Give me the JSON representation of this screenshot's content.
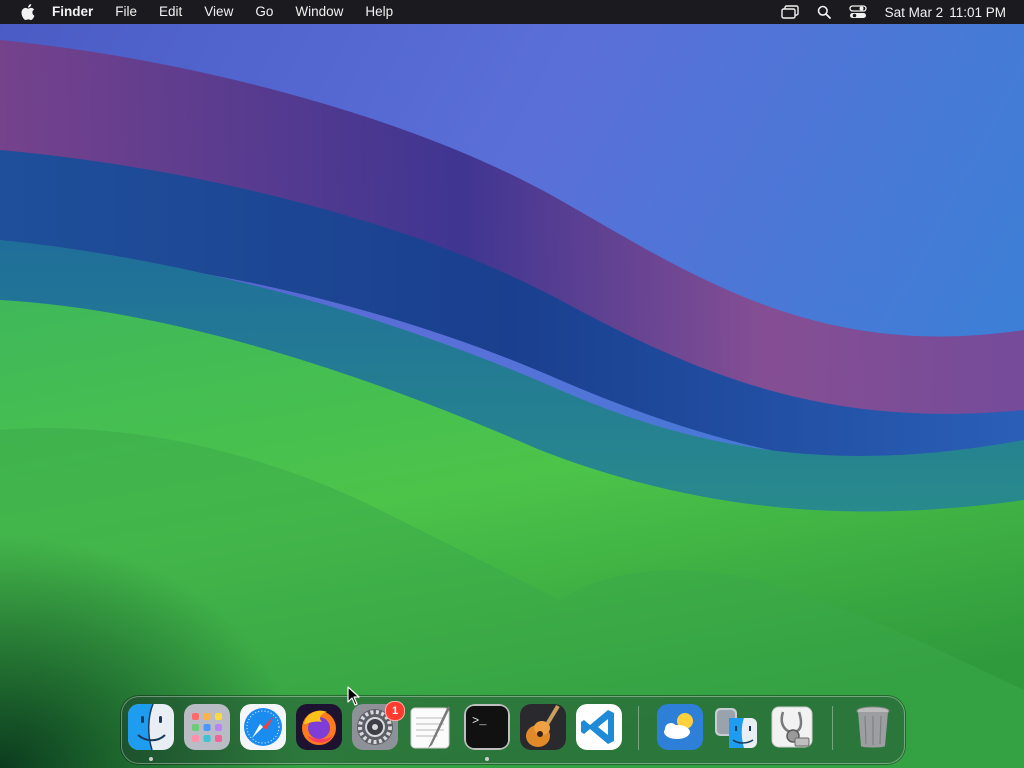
{
  "menubar": {
    "apple_icon": "apple-logo-icon",
    "app_name": "Finder",
    "items": [
      "File",
      "Edit",
      "View",
      "Go",
      "Window",
      "Help"
    ],
    "status_icons": [
      "screen-mirroring-icon",
      "spotlight-search-icon",
      "control-center-icon"
    ],
    "clock": {
      "date": "Sat Mar 2",
      "time": "11:01 PM"
    }
  },
  "dock": {
    "apps": [
      {
        "name": "Finder",
        "icon": "finder-icon",
        "running": true
      },
      {
        "name": "Launchpad",
        "icon": "launchpad-icon",
        "running": false
      },
      {
        "name": "Safari",
        "icon": "safari-icon",
        "running": false
      },
      {
        "name": "Firefox",
        "icon": "firefox-icon",
        "running": false
      },
      {
        "name": "System Settings",
        "icon": "system-settings-icon",
        "running": false,
        "badge": "1"
      },
      {
        "name": "TextEdit",
        "icon": "textedit-icon",
        "running": false
      },
      {
        "name": "Terminal",
        "icon": "terminal-icon",
        "running": true
      },
      {
        "name": "GarageBand",
        "icon": "garageband-icon",
        "running": false
      },
      {
        "name": "Visual Studio Code",
        "icon": "vscode-icon",
        "running": false
      },
      {
        "name": "Weather",
        "icon": "weather-icon",
        "running": false
      },
      {
        "name": "Migration Assistant",
        "icon": "migration-assistant-icon",
        "running": false
      },
      {
        "name": "Disk Utility",
        "icon": "disk-utility-icon",
        "running": false
      },
      {
        "name": "Trash",
        "icon": "trash-icon",
        "running": false
      }
    ]
  },
  "colors": {
    "menubar_bg": "#1b1b1f",
    "badge": "#ff3b30",
    "wallpaper_green": "#4cc44a",
    "wallpaper_blue": "#3f5fc8",
    "wallpaper_magenta": "#8a4a8c"
  }
}
